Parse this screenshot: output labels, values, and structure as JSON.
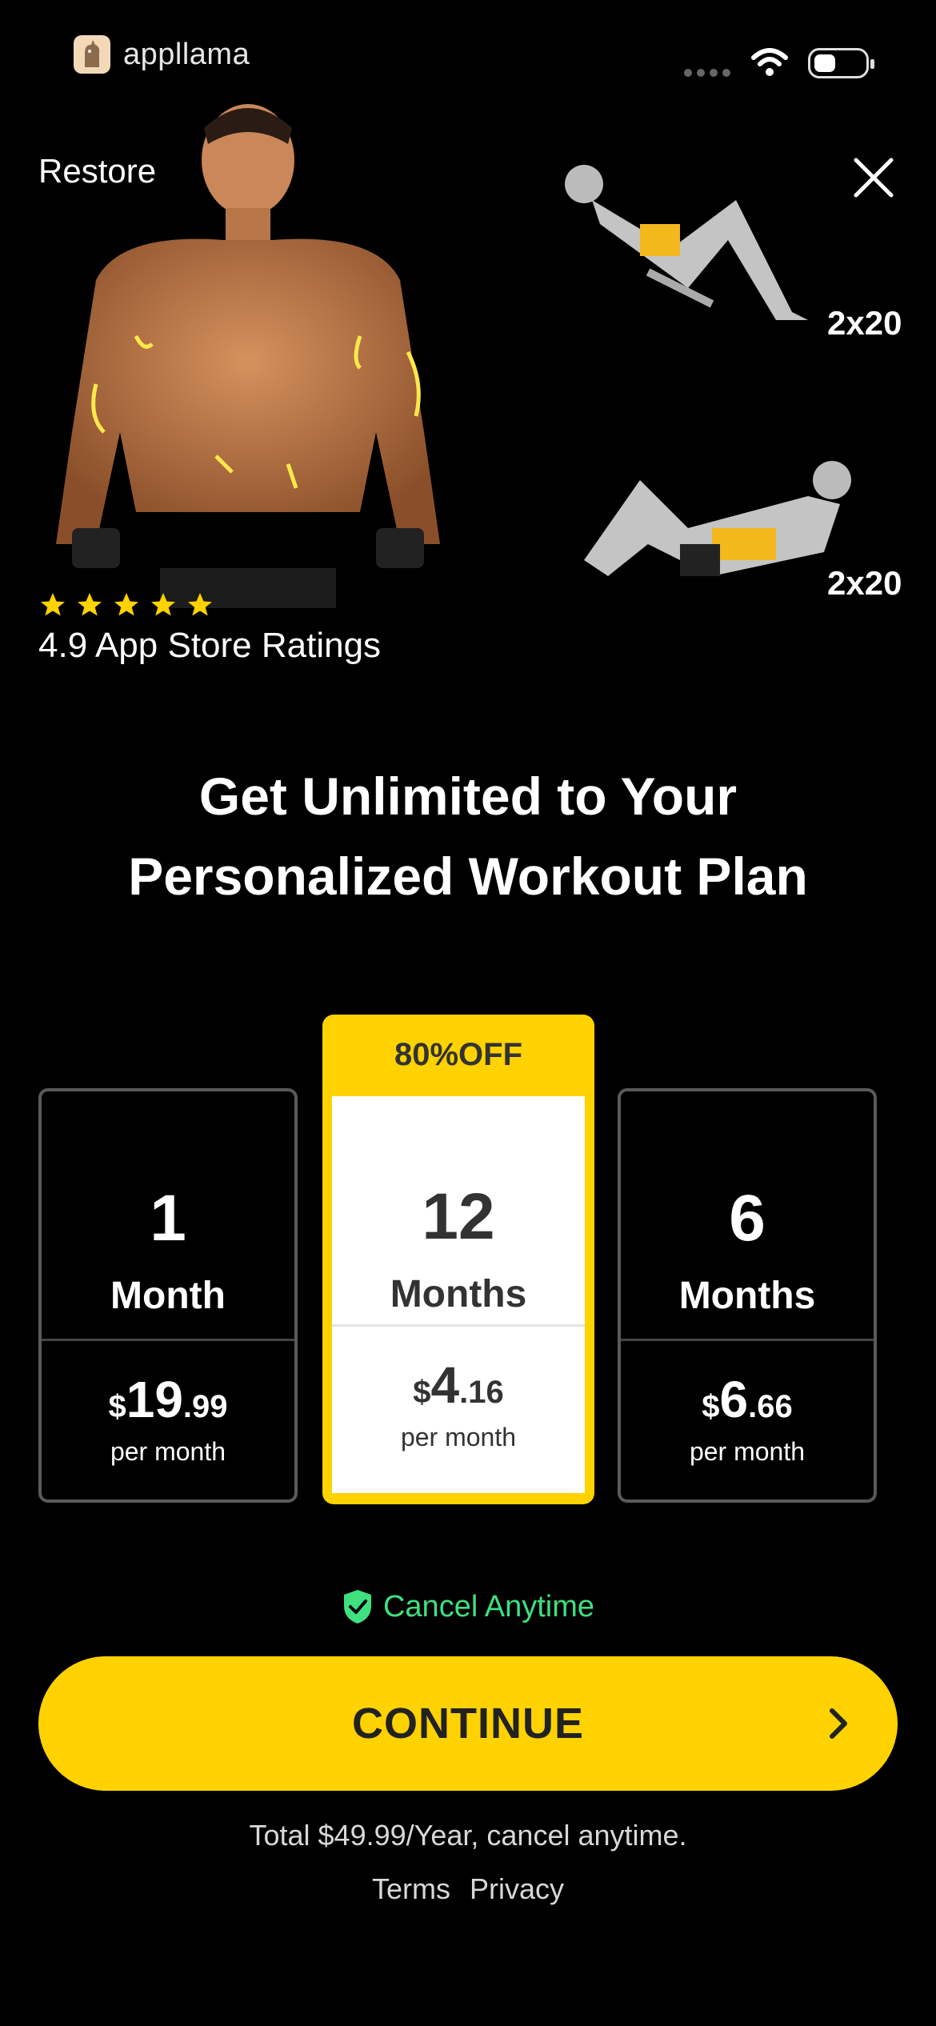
{
  "status_bar": {
    "brand_name": "appllama",
    "icons": [
      "appllama-logo-icon",
      "signal-icon",
      "wifi-icon",
      "battery-icon"
    ]
  },
  "hero": {
    "restore_label": "Restore",
    "close_icon": "close-icon",
    "rep_1": "2x20",
    "rep_2": "2x20",
    "stars": 5,
    "rating_text": "4.9 App Store Ratings"
  },
  "headline": {
    "line1": "Get Unlimited to Your",
    "line2": "Personalized Workout Plan"
  },
  "plans": [
    {
      "num": "1",
      "unit": "Month",
      "currency": "$",
      "price_main": "19",
      "price_cents": ".99",
      "per": "per month"
    },
    {
      "num": "12",
      "unit": "Months",
      "currency": "$",
      "price_main": "4",
      "price_cents": ".16",
      "per": "per month",
      "badge": "80%OFF",
      "selected": true
    },
    {
      "num": "6",
      "unit": "Months",
      "currency": "$",
      "price_main": "6",
      "price_cents": ".66",
      "per": "per month"
    }
  ],
  "cancel_anytime": "Cancel Anytime",
  "continue_label": "CONTINUE",
  "total_text": "Total $49.99/Year, cancel anytime.",
  "links": {
    "terms": "Terms",
    "privacy": "Privacy"
  },
  "colors": {
    "accent": "#ffd200",
    "success": "#3ee07f",
    "background": "#000000"
  }
}
